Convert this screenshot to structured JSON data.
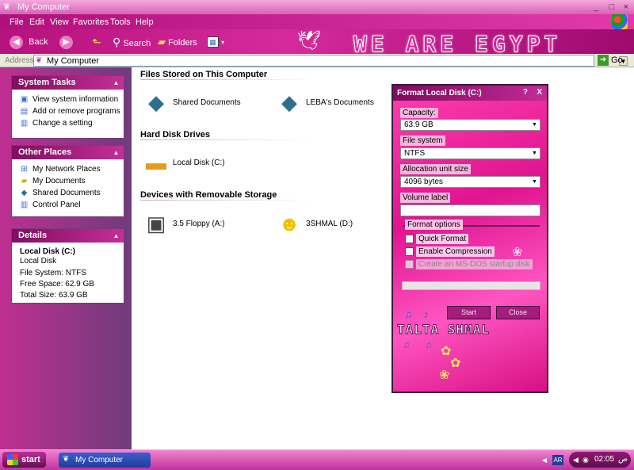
{
  "window": {
    "title": "My Computer",
    "buttons": {
      "minimize": "_",
      "maximize": "□",
      "close": "×"
    }
  },
  "menu": [
    "File",
    "Edit",
    "View",
    "Favorites",
    "Tools",
    "Help"
  ],
  "toolbar": {
    "back": "Back",
    "search": "Search",
    "folders": "Folders",
    "banner": "WE ARE EGYPT"
  },
  "address": {
    "label": "Address",
    "value": "My Computer",
    "go": "Go"
  },
  "sidebar": {
    "system_tasks": {
      "title": "System Tasks",
      "items": [
        {
          "label": "View system information",
          "icon": "info-icon"
        },
        {
          "label": "Add or remove programs",
          "icon": "programs-icon"
        },
        {
          "label": "Change a setting",
          "icon": "control-panel-icon"
        }
      ]
    },
    "other_places": {
      "title": "Other Places",
      "items": [
        {
          "label": "My Network Places",
          "icon": "network-icon"
        },
        {
          "label": "My Documents",
          "icon": "folder-icon"
        },
        {
          "label": "Shared Documents",
          "icon": "shared-folder-icon"
        },
        {
          "label": "Control Panel",
          "icon": "control-panel-icon"
        }
      ]
    },
    "details": {
      "title": "Details",
      "name": "Local Disk (C:)",
      "type": "Local Disk",
      "file_system": "File System: NTFS",
      "free_space": "Free Space: 62.9 GB",
      "total_size": "Total Size: 63.9 GB"
    }
  },
  "main": {
    "sections": [
      {
        "title": "Files Stored on This Computer",
        "items": [
          {
            "label": "Shared Documents",
            "icon": "shared-folder-icon"
          },
          {
            "label": "LEBA's Documents",
            "icon": "shared-folder-icon"
          }
        ]
      },
      {
        "title": "Hard Disk Drives",
        "items": [
          {
            "label": "Local Disk (C:)",
            "icon": "hard-disk-icon"
          }
        ]
      },
      {
        "title": "Devices with Removable Storage",
        "items": [
          {
            "label": "3.5 Floppy (A:)",
            "icon": "floppy-icon"
          },
          {
            "label": "3SHMAL (D:)",
            "icon": "smiley-drive-icon"
          }
        ]
      }
    ]
  },
  "format_dialog": {
    "title": "Format Local Disk (C:)",
    "help": "?",
    "close_x": "X",
    "capacity_label": "Capacity:",
    "capacity_value": "63.9 GB",
    "filesystem_label": "File system",
    "filesystem_value": "NTFS",
    "alloc_label": "Allocation unit size",
    "alloc_value": "4096 bytes",
    "volume_label": "Volume label",
    "volume_value": "",
    "options_label": "Format options",
    "quick_format": "Quick Format",
    "enable_compression": "Enable Compression",
    "msdos_startup": "Create an MS-DOS startup disk",
    "progress": 0,
    "start": "Start",
    "close": "Close",
    "skin_text": "TALTA SHMAL"
  },
  "taskbar": {
    "start": "start",
    "task": "My Computer",
    "lang": "AR",
    "time": "02:05",
    "ampm": "ص"
  },
  "colors": {
    "accent": "#d4259b",
    "dialog_bg": "#e0148f",
    "sidebar_bg": "#bf2f92",
    "taskbar_task": "#2a4aba"
  }
}
